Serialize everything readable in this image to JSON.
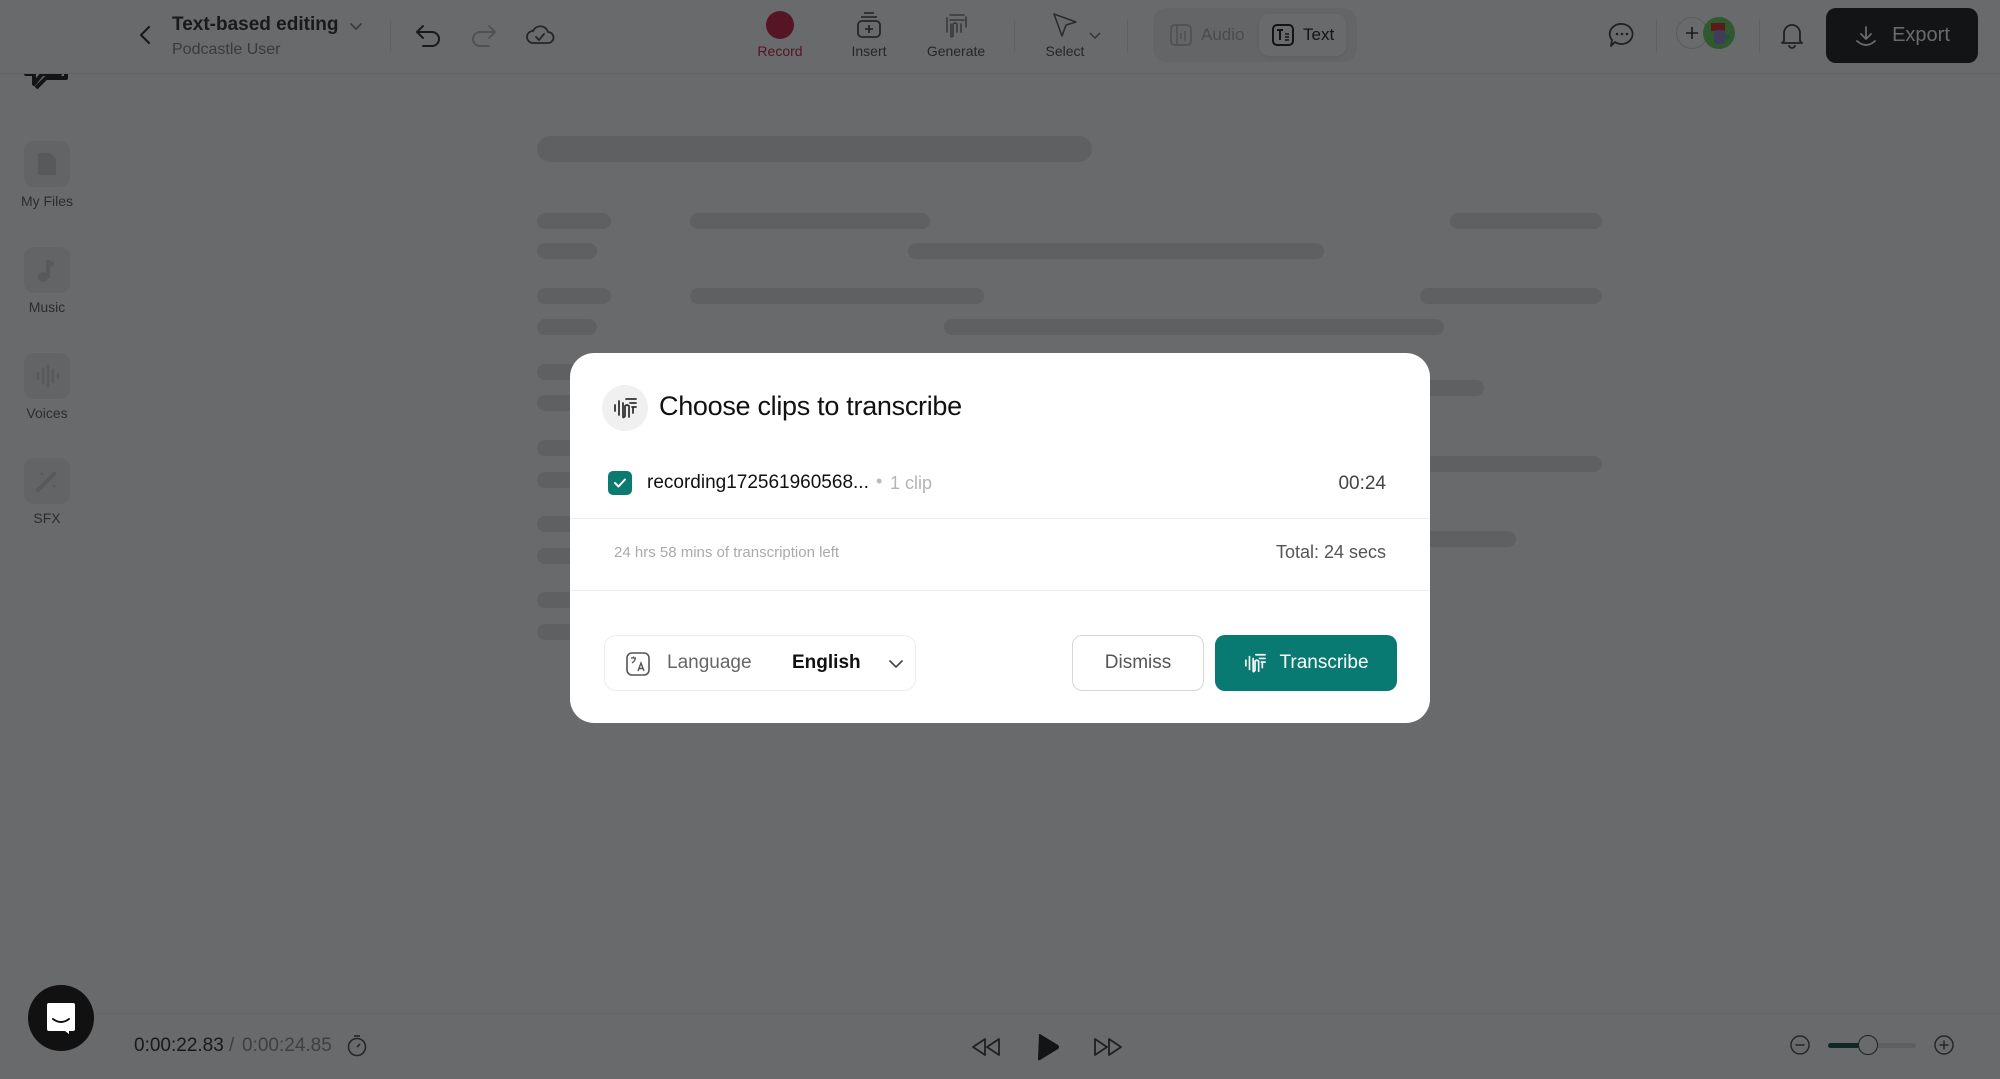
{
  "sidebar": {
    "items": [
      {
        "label": "My Files",
        "icon": "file-icon"
      },
      {
        "label": "Music",
        "icon": "music-note-icon"
      },
      {
        "label": "Voices",
        "icon": "waveform-icon"
      },
      {
        "label": "SFX",
        "icon": "magic-wand-icon"
      }
    ]
  },
  "header": {
    "project_title": "Text-based editing",
    "project_owner": "Podcastle User",
    "tools": [
      {
        "label": "Record",
        "icon": "record-icon"
      },
      {
        "label": "Insert",
        "icon": "insert-icon"
      },
      {
        "label": "Generate",
        "icon": "generate-icon"
      },
      {
        "label": "Select",
        "icon": "cursor-icon"
      }
    ],
    "modes": [
      {
        "label": "Audio",
        "active": false
      },
      {
        "label": "Text",
        "active": true
      }
    ],
    "export_label": "Export"
  },
  "player": {
    "current_time": "0:00:22.83",
    "separator": "/",
    "total_time": "0:00:24.85",
    "zoom_level_fraction": 0.45
  },
  "modal": {
    "title": "Choose clips to transcribe",
    "clips": [
      {
        "name": "recording172561960568...",
        "bullet": "•",
        "count": "1 clip",
        "duration": "00:24",
        "checked": true
      }
    ],
    "quota_text": "24 hrs 58 mins of transcription left",
    "total_text": "Total: 24 secs",
    "language_label": "Language",
    "language_value": "English",
    "dismiss_label": "Dismiss",
    "transcribe_label": "Transcribe"
  },
  "colors": {
    "accent": "#097a72",
    "record": "#c8143f",
    "export_bg": "#111111"
  }
}
